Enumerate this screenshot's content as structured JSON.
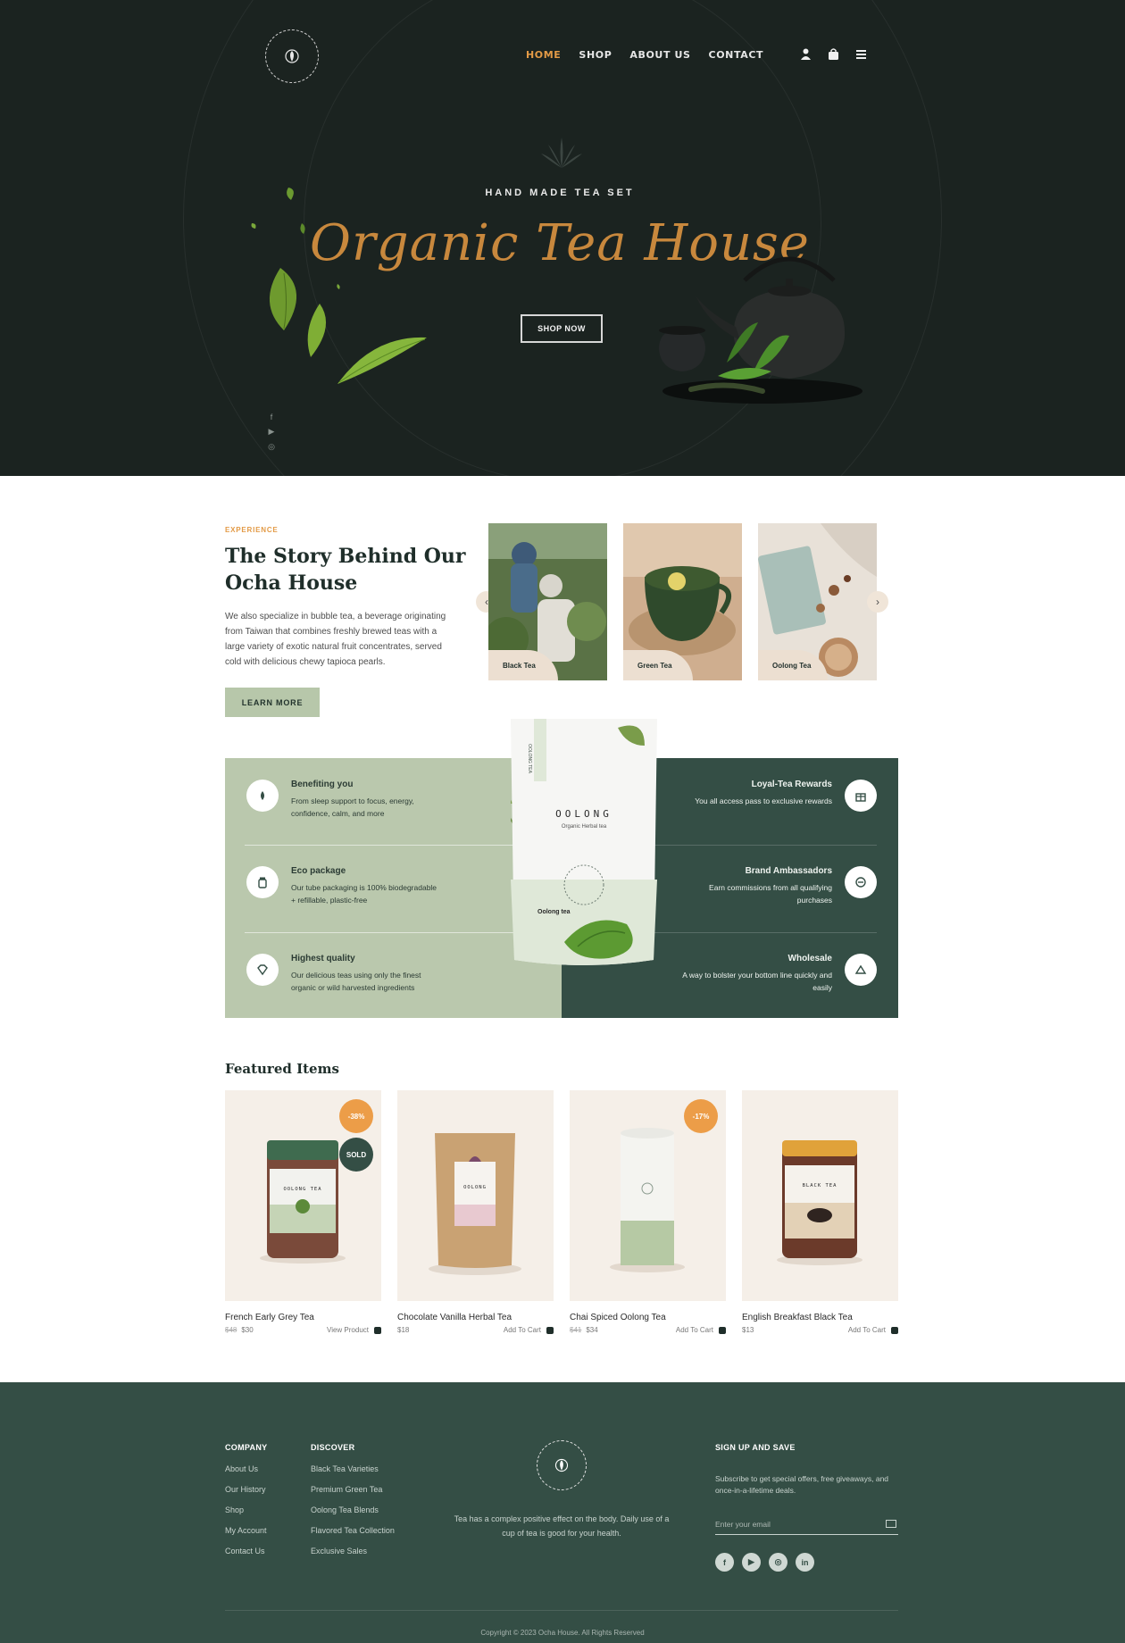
{
  "nav": {
    "items": [
      {
        "label": "HOME",
        "active": true
      },
      {
        "label": "SHOP",
        "active": false
      },
      {
        "label": "ABOUT US",
        "active": false
      },
      {
        "label": "CONTACT",
        "active": false
      }
    ],
    "icons": [
      "user-icon",
      "shopping-bag-icon",
      "menu-icon"
    ]
  },
  "hero": {
    "subtitle": "HAND MADE TEA SET",
    "title": "Organic Tea House",
    "cta": "SHOP NOW",
    "social": [
      "facebook-icon",
      "youtube-icon",
      "instagram-icon"
    ],
    "social_glyphs": [
      "f",
      "▶",
      "◎"
    ]
  },
  "story": {
    "eyebrow": "EXPERIENCE",
    "title": "The Story Behind Our Ocha House",
    "text": "We also specialize in bubble tea, a beverage originating from Taiwan that combines freshly brewed teas with a large variety of exotic natural fruit concentrates, served cold with delicious chewy tapioca pearls.",
    "button": "LEARN MORE",
    "cards": [
      {
        "label": "Black Tea"
      },
      {
        "label": "Green Tea"
      },
      {
        "label": "Oolong Tea"
      }
    ],
    "prev_glyph": "‹",
    "next_glyph": "›"
  },
  "features": {
    "left": [
      {
        "title": "Benefiting you",
        "text": "From sleep support to focus, energy, confidence, calm, and more",
        "icon": "leaf-icon"
      },
      {
        "title": "Eco package",
        "text": "Our tube packaging is 100% biodegradable + refillable, plastic-free",
        "icon": "jar-icon"
      },
      {
        "title": "Highest quality",
        "text": "Our delicious teas using only the finest organic or wild harvested ingredients",
        "icon": "diamond-icon"
      }
    ],
    "right": [
      {
        "title": "Loyal-Tea Rewards",
        "text": "You all access pass to exclusive rewards",
        "icon": "gift-icon"
      },
      {
        "title": "Brand Ambassadors",
        "text": "Earn commissions from all qualifying purchases",
        "icon": "handshake-icon"
      },
      {
        "title": "Wholesale",
        "text": "A way to bolster your bottom line quickly and easily",
        "icon": "cart-icon"
      }
    ],
    "product_bag": {
      "brand": "OOLONG",
      "sub": "Organic Herbal tea",
      "label": "Oolong tea",
      "side": "OOLONG TEA"
    }
  },
  "featured": {
    "title": "Featured Items",
    "products": [
      {
        "name": "French Early Grey Tea",
        "old_price": "$48",
        "price": "$30",
        "action": "View Product",
        "badge": "-38%",
        "badge2": "SOLD",
        "jar_label": "OOLONG TEA"
      },
      {
        "name": "Chocolate Vanilla Herbal Tea",
        "old_price": "",
        "price": "$18",
        "action": "Add To Cart",
        "badge": "",
        "badge2": "",
        "jar_label": "OOLONG"
      },
      {
        "name": "Chai Spiced Oolong Tea",
        "old_price": "$41",
        "price": "$34",
        "action": "Add To Cart",
        "badge": "-17%",
        "badge2": "",
        "jar_label": ""
      },
      {
        "name": "English Breakfast Black Tea",
        "old_price": "",
        "price": "$13",
        "action": "Add To Cart",
        "badge": "",
        "badge2": "",
        "jar_label": "BLACK TEA"
      }
    ]
  },
  "footer": {
    "company": {
      "title": "COMPANY",
      "links": [
        "About Us",
        "Our History",
        "Shop",
        "My Account",
        "Contact Us"
      ]
    },
    "discover": {
      "title": "DISCOVER",
      "links": [
        "Black Tea Varieties",
        "Premium Green Tea",
        "Oolong Tea Blends",
        "Flavored Tea Collection",
        "Exclusive Sales"
      ]
    },
    "tagline": "Tea has a complex positive effect on the body. Daily use of a cup of tea is good for your health.",
    "signup": {
      "title": "SIGN UP AND SAVE",
      "text": "Subscribe to get special offers, free giveaways, and once-in-a-lifetime deals.",
      "placeholder": "Enter your email"
    },
    "social": [
      "facebook-icon",
      "youtube-icon",
      "instagram-icon",
      "linkedin-icon"
    ],
    "social_glyphs": [
      "f",
      "▶",
      "◎",
      "in"
    ],
    "copyright": "Copyright © 2023 Ocha House. All Rights Reserved"
  },
  "colors": {
    "hero_bg": "#1b2320",
    "accent": "#e39a46",
    "sage": "#bac8ad",
    "forest": "#344e45",
    "cream": "#f5efe8"
  }
}
